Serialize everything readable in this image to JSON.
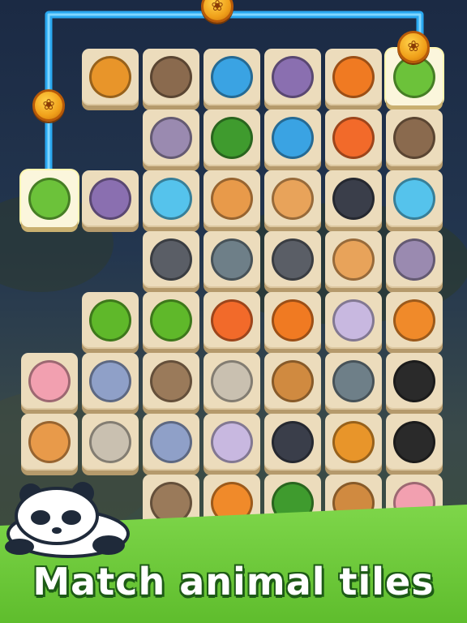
{
  "caption": "Match animal tiles",
  "colors": {
    "path": "#2aa8f0",
    "tile": "#ecdcbc",
    "tile_selected": "#fbf6dc",
    "ground": "#6fcc3a",
    "caption_outline": "#1d5a16"
  },
  "coins": [
    {
      "name": "paw-coin-top",
      "icon": "paw-icon"
    },
    {
      "name": "paw-coin-left",
      "icon": "paw-icon"
    },
    {
      "name": "paw-coin-right",
      "icon": "paw-icon"
    }
  ],
  "animal_colors": {
    "lion": "#e8952a",
    "hedgehog": "#8a6a4e",
    "dolphin": "#3aa3e3",
    "cow": "#8a6fb0",
    "fox": "#f07a22",
    "turtle": "#6cc23a",
    "hippo": "#9a8ab0",
    "parrot": "#3f9b2e",
    "clownfish": "#f26a2a",
    "octopus": "#55c3ec",
    "shiba": "#e89a4a",
    "hamster": "#e8a35a",
    "penguin": "#3a3e4a",
    "raccoon": "#5a5e66",
    "seal": "#6e7f88",
    "snake": "#5fb82a",
    "cat": "#c8b8e0",
    "tiger": "#f08a2a",
    "pig": "#f2a0b0",
    "elephant": "#8fa0c8",
    "sloth": "#9a7a5a",
    "sheep": "#c9c0b0",
    "deer": "#d08a40",
    "panda": "#2a2a2a"
  },
  "board": [
    {
      "row": 0,
      "tiles": [
        {
          "col": 1,
          "animal": "lion"
        },
        {
          "col": 2,
          "animal": "hedgehog"
        },
        {
          "col": 3,
          "animal": "dolphin"
        },
        {
          "col": 4,
          "animal": "cow"
        },
        {
          "col": 5,
          "animal": "fox"
        },
        {
          "col": 6,
          "animal": "turtle",
          "selected": true
        }
      ]
    },
    {
      "row": 1,
      "tiles": [
        {
          "col": 2,
          "animal": "hippo"
        },
        {
          "col": 3,
          "animal": "parrot"
        },
        {
          "col": 4,
          "animal": "dolphin"
        },
        {
          "col": 5,
          "animal": "clownfish"
        },
        {
          "col": 6,
          "animal": "hedgehog"
        }
      ]
    },
    {
      "row": 2,
      "tiles": [
        {
          "col": 0,
          "animal": "turtle",
          "selected": true
        },
        {
          "col": 1,
          "animal": "cow"
        },
        {
          "col": 2,
          "animal": "octopus"
        },
        {
          "col": 3,
          "animal": "shiba"
        },
        {
          "col": 4,
          "animal": "hamster"
        },
        {
          "col": 5,
          "animal": "penguin"
        },
        {
          "col": 6,
          "animal": "octopus"
        }
      ]
    },
    {
      "row": 3,
      "tiles": [
        {
          "col": 2,
          "animal": "raccoon"
        },
        {
          "col": 3,
          "animal": "seal"
        },
        {
          "col": 4,
          "animal": "raccoon"
        },
        {
          "col": 5,
          "animal": "hamster"
        },
        {
          "col": 6,
          "animal": "hippo"
        }
      ]
    },
    {
      "row": 4,
      "tiles": [
        {
          "col": 1,
          "animal": "snake"
        },
        {
          "col": 2,
          "animal": "snake"
        },
        {
          "col": 3,
          "animal": "clownfish"
        },
        {
          "col": 4,
          "animal": "fox"
        },
        {
          "col": 5,
          "animal": "cat"
        },
        {
          "col": 6,
          "animal": "tiger"
        }
      ]
    },
    {
      "row": 5,
      "tiles": [
        {
          "col": 0,
          "animal": "pig"
        },
        {
          "col": 1,
          "animal": "elephant"
        },
        {
          "col": 2,
          "animal": "sloth"
        },
        {
          "col": 3,
          "animal": "sheep"
        },
        {
          "col": 4,
          "animal": "deer"
        },
        {
          "col": 5,
          "animal": "seal"
        },
        {
          "col": 6,
          "animal": "panda"
        }
      ]
    },
    {
      "row": 6,
      "tiles": [
        {
          "col": 0,
          "animal": "shiba"
        },
        {
          "col": 1,
          "animal": "sheep"
        },
        {
          "col": 2,
          "animal": "elephant"
        },
        {
          "col": 3,
          "animal": "cat"
        },
        {
          "col": 4,
          "animal": "penguin"
        },
        {
          "col": 5,
          "animal": "lion"
        },
        {
          "col": 6,
          "animal": "panda"
        }
      ]
    },
    {
      "row": 7,
      "tiles": [
        {
          "col": 2,
          "animal": "sloth"
        },
        {
          "col": 3,
          "animal": "tiger"
        },
        {
          "col": 4,
          "animal": "parrot"
        },
        {
          "col": 5,
          "animal": "deer"
        },
        {
          "col": 6,
          "animal": "pig"
        }
      ]
    }
  ],
  "mascot": {
    "icon": "sleeping-panda-icon"
  }
}
